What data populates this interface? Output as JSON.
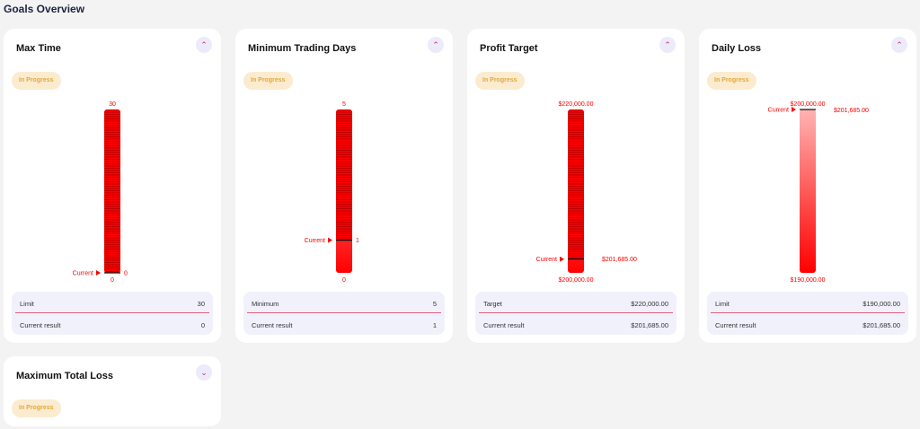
{
  "page": {
    "title": "Goals Overview"
  },
  "cards": [
    {
      "title": "Max Time",
      "status": "In Progress",
      "collapse_icon": "chevron-up-icon",
      "collapse_glyph": "⌃",
      "gauge": {
        "top_label": "30",
        "bottom_label": "0",
        "current_label": "Current",
        "current_value_label": "0",
        "fill_fraction": 1.0,
        "marker_fraction": 0.0
      },
      "info": {
        "row1_label": "Limit",
        "row1_value": "30",
        "row2_label": "Current result",
        "row2_value": "0"
      }
    },
    {
      "title": "Minimum Trading Days",
      "status": "In Progress",
      "collapse_icon": "chevron-up-icon",
      "collapse_glyph": "⌃",
      "gauge": {
        "top_label": "5",
        "bottom_label": "0",
        "current_label": "Current",
        "current_value_label": "1",
        "fill_fraction": 0.2,
        "marker_fraction": 0.2
      },
      "info": {
        "row1_label": "Minimum",
        "row1_value": "5",
        "row2_label": "Current result",
        "row2_value": "1"
      }
    },
    {
      "title": "Profit Target",
      "status": "In Progress",
      "collapse_icon": "chevron-up-icon",
      "collapse_glyph": "⌃",
      "gauge": {
        "top_label": "$220,000.00",
        "bottom_label": "$200,000.00",
        "current_label": "Current",
        "current_value_label": "$201,685.00",
        "fill_fraction": 0.084,
        "marker_fraction": 0.084
      },
      "info": {
        "row1_label": "Target",
        "row1_value": "$220,000.00",
        "row2_label": "Current result",
        "row2_value": "$201,685.00"
      }
    },
    {
      "title": "Daily Loss",
      "status": "In Progress",
      "collapse_icon": "chevron-up-icon",
      "collapse_glyph": "⌃",
      "gauge": {
        "top_label": "$200,000.00",
        "bottom_label": "$190,000.00",
        "current_label": "Current",
        "current_value_label": "$201,685.00",
        "fill_fraction": 0.0,
        "marker_fraction": 1.0
      },
      "info": {
        "row1_label": "Limit",
        "row1_value": "$190,000.00",
        "row2_label": "Current result",
        "row2_value": "$201,685.00"
      }
    },
    {
      "title": "Maximum Total Loss",
      "status": "In Progress",
      "collapse_icon": "chevron-down-icon",
      "collapse_glyph": "⌄"
    }
  ],
  "colors": {
    "accent": "#ff0000",
    "badge_bg": "#fbebcf",
    "badge_text": "#e2a93b",
    "divider": "#d9607a",
    "info_bg": "#f1f1fb",
    "collapse_bg": "#ecebfb",
    "collapse_icon": "#e0245e"
  }
}
